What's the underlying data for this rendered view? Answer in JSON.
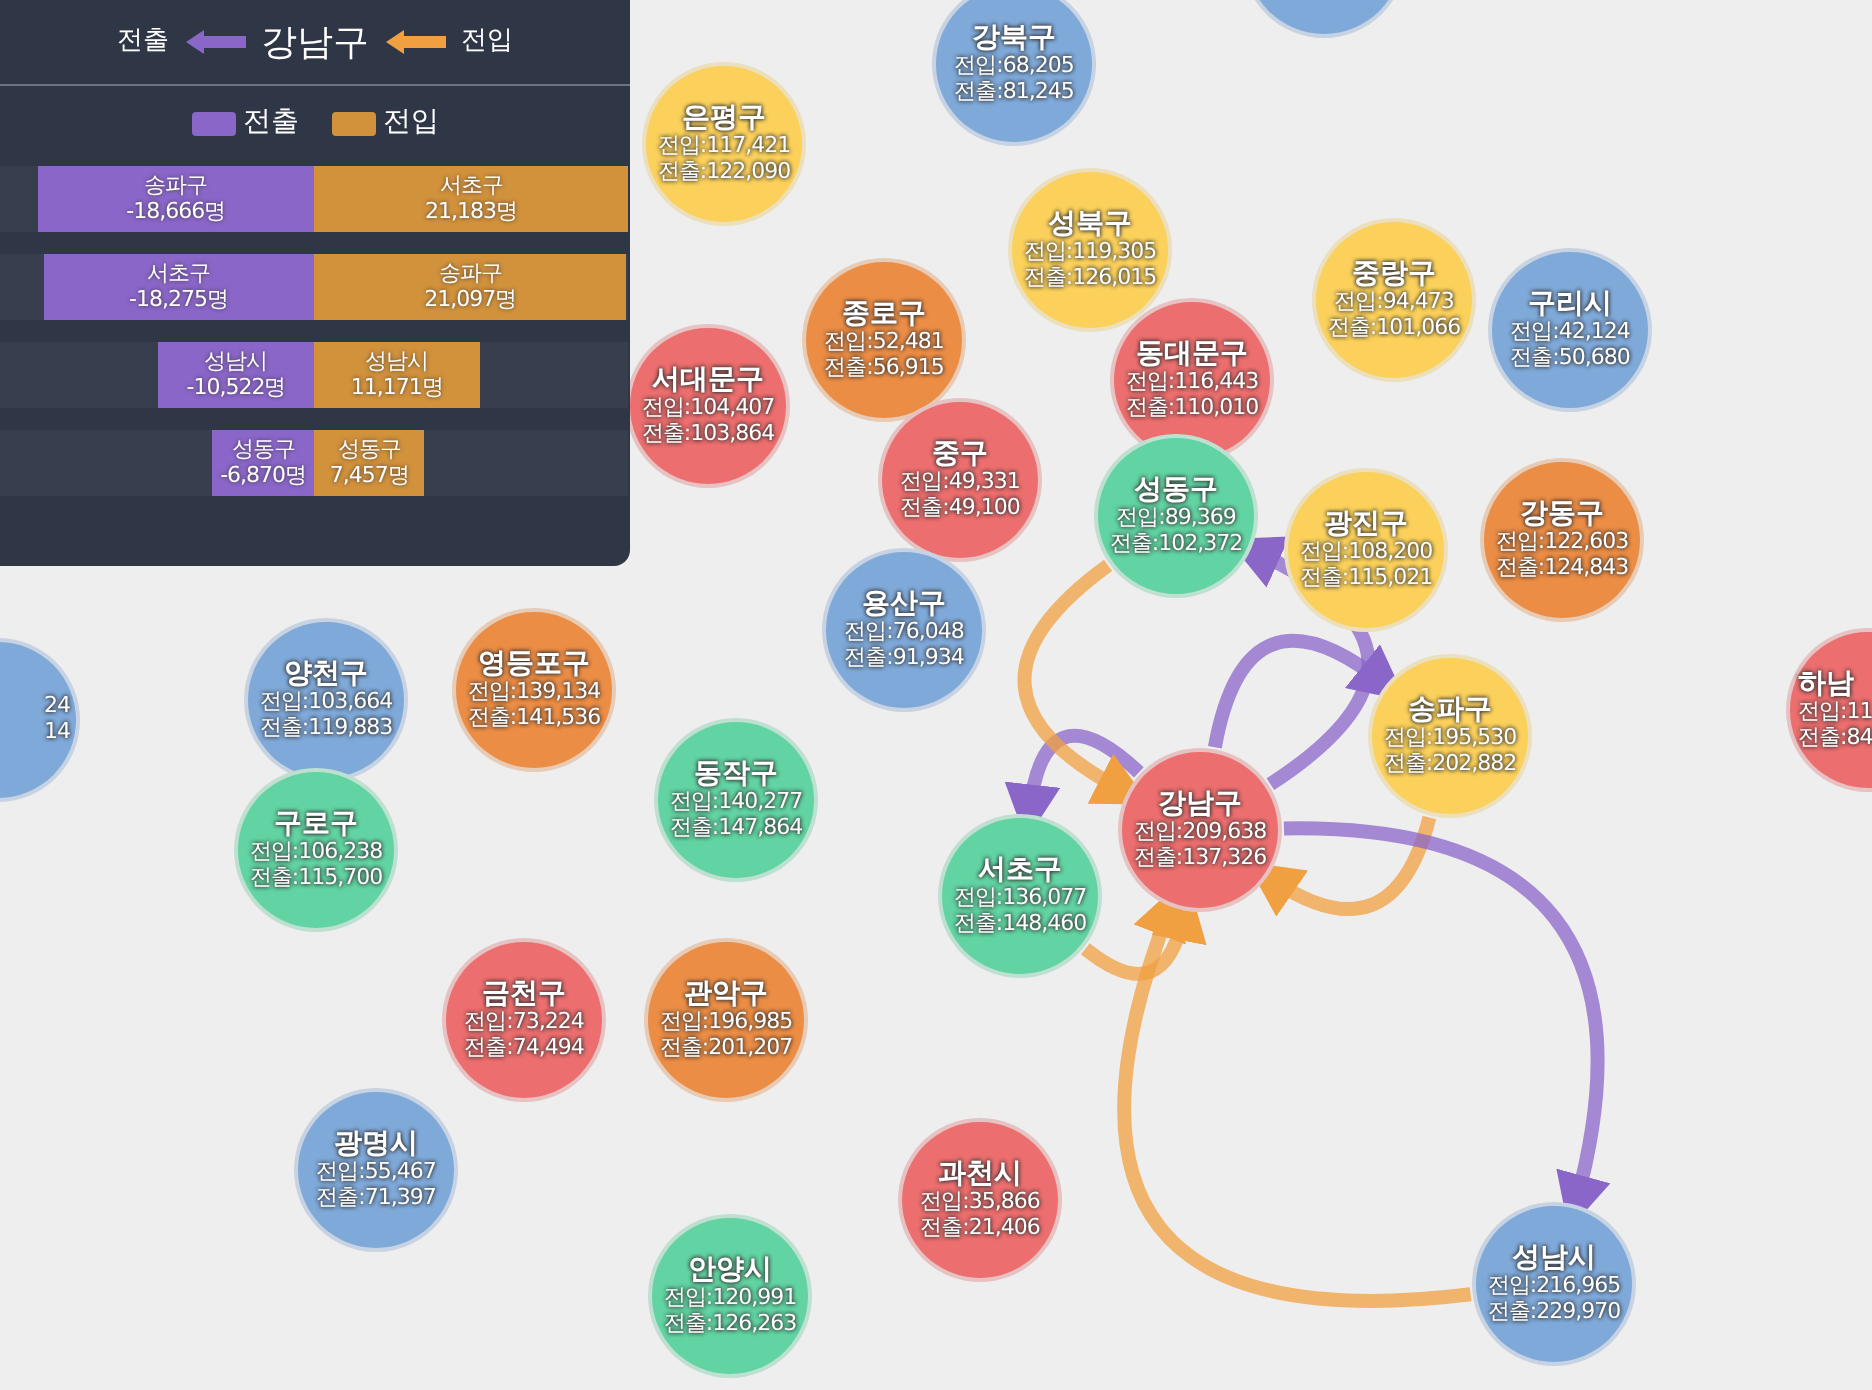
{
  "panel": {
    "title": {
      "out_label": "전출",
      "district": "강남구",
      "in_label": "전입"
    },
    "legend": [
      {
        "kind": "out",
        "label": "전출"
      },
      {
        "kind": "in",
        "label": "전입"
      }
    ],
    "bars": [
      {
        "out": {
          "name": "송파구",
          "value": "-18,666명",
          "level": 0.881
        },
        "in": {
          "name": "서초구",
          "value": "21,183명",
          "level": 1.0
        }
      },
      {
        "out": {
          "name": "서초구",
          "value": "-18,275명",
          "level": 0.863
        },
        "in": {
          "name": "송파구",
          "value": "21,097명",
          "level": 0.996
        }
      },
      {
        "out": {
          "name": "성남시",
          "value": "-10,522명",
          "level": 0.497
        },
        "in": {
          "name": "성남시",
          "value": "11,171명",
          "level": 0.527
        }
      },
      {
        "out": {
          "name": "성동구",
          "value": "-6,870명",
          "level": 0.324
        },
        "in": {
          "name": "성동구",
          "value": "7,457명",
          "level": 0.352
        }
      }
    ]
  },
  "bubbles": [
    {
      "kind": "full",
      "name": "강북구",
      "color": "#7fa9d9",
      "lines": [
        "전입:68,205",
        "전출:81,245"
      ]
    },
    {
      "kind": "edge-top",
      "color": "#7fa9d9"
    },
    {
      "kind": "full",
      "name": "은평구",
      "color": "#fbd15c",
      "lines": [
        "전입:117,421",
        "전출:122,090"
      ]
    },
    {
      "kind": "full",
      "name": "성북구",
      "color": "#fbd15c",
      "lines": [
        "전입:119,305",
        "전출:126,015"
      ]
    },
    {
      "kind": "full",
      "name": "서대문구",
      "color": "#ec6e6e",
      "lines": [
        "전입:104,407",
        "전출:103,864"
      ]
    },
    {
      "kind": "full",
      "name": "종로구",
      "color": "#ec8d45",
      "lines": [
        "전입:52,481",
        "전출:56,915"
      ]
    },
    {
      "kind": "full",
      "name": "동대문구",
      "color": "#ec6e6e",
      "lines": [
        "전입:116,443",
        "전출:110,010"
      ]
    },
    {
      "kind": "full",
      "name": "중랑구",
      "color": "#fbd15c",
      "lines": [
        "전입:94,473",
        "전출:101,066"
      ]
    },
    {
      "kind": "full",
      "name": "구리시",
      "color": "#7fa9d9",
      "lines": [
        "전입:42,124",
        "전출:50,680"
      ]
    },
    {
      "kind": "full",
      "name": "중구",
      "color": "#ec6e6e",
      "lines": [
        "전입:49,331",
        "전출:49,100"
      ]
    },
    {
      "kind": "full",
      "name": "성동구",
      "color": "#62d3a2",
      "lines": [
        "전입:89,369",
        "전출:102,372"
      ]
    },
    {
      "kind": "full",
      "name": "광진구",
      "color": "#fbd15c",
      "lines": [
        "전입:108,200",
        "전출:115,021"
      ]
    },
    {
      "kind": "full",
      "name": "강동구",
      "color": "#ec8d45",
      "lines": [
        "전입:122,603",
        "전출:124,843"
      ]
    },
    {
      "kind": "edge-left",
      "color": "#7fa9d9",
      "lines": [
        "24",
        "14"
      ]
    },
    {
      "kind": "full",
      "name": "양천구",
      "color": "#7fa9d9",
      "lines": [
        "전입:103,664",
        "전출:119,883"
      ]
    },
    {
      "kind": "full",
      "name": "영등포구",
      "color": "#ec8d45",
      "lines": [
        "전입:139,134",
        "전출:141,536"
      ]
    },
    {
      "kind": "full",
      "name": "용산구",
      "color": "#7fa9d9",
      "lines": [
        "전입:76,048",
        "전출:91,934"
      ]
    },
    {
      "kind": "full",
      "name": "송파구",
      "color": "#fbd15c",
      "lines": [
        "전입:195,530",
        "전출:202,882"
      ]
    },
    {
      "kind": "edge-right",
      "name": "하남",
      "color": "#ec6e6e",
      "lines": [
        "전입:11",
        "전출:84"
      ]
    },
    {
      "kind": "full",
      "name": "구로구",
      "color": "#62d3a2",
      "lines": [
        "전입:106,238",
        "전출:115,700"
      ]
    },
    {
      "kind": "full",
      "name": "동작구",
      "color": "#62d3a2",
      "lines": [
        "전입:140,277",
        "전출:147,864"
      ]
    },
    {
      "kind": "full",
      "name": "서초구",
      "color": "#62d3a2",
      "lines": [
        "전입:136,077",
        "전출:148,460"
      ]
    },
    {
      "kind": "full",
      "name": "강남구",
      "color": "#ec6e6e",
      "lines": [
        "전입:209,638",
        "전출:137,326"
      ]
    },
    {
      "kind": "full",
      "name": "금천구",
      "color": "#ec6e6e",
      "lines": [
        "전입:73,224",
        "전출:74,494"
      ]
    },
    {
      "kind": "full",
      "name": "관악구",
      "color": "#ec8d45",
      "lines": [
        "전입:196,985",
        "전출:201,207"
      ]
    },
    {
      "kind": "full",
      "name": "광명시",
      "color": "#7fa9d9",
      "lines": [
        "전입:55,467",
        "전출:71,397"
      ]
    },
    {
      "kind": "full",
      "name": "안양시",
      "color": "#62d3a2",
      "lines": [
        "전입:120,991",
        "전출:126,263"
      ]
    },
    {
      "kind": "full",
      "name": "과천시",
      "color": "#ec6e6e",
      "lines": [
        "전입:35,866",
        "전출:21,406"
      ]
    },
    {
      "kind": "full",
      "name": "성남시",
      "color": "#7fa9d9",
      "lines": [
        "전입:216,965",
        "전출:229,970"
      ]
    }
  ],
  "flows": [
    {
      "kind": "out"
    },
    {
      "kind": "in"
    },
    {
      "kind": "out"
    },
    {
      "kind": "in"
    },
    {
      "kind": "out"
    },
    {
      "kind": "in"
    },
    {
      "kind": "out"
    },
    {
      "kind": "in"
    }
  ]
}
